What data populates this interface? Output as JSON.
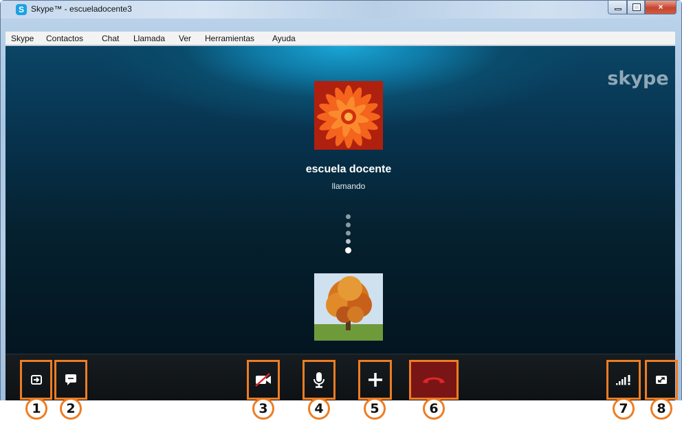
{
  "window": {
    "title": "Skype™ - escueladocente3",
    "app_icon_letter": "S",
    "controls": {
      "minimize": "minimize-icon",
      "maximize": "maximize-icon",
      "close": "×"
    }
  },
  "menu": [
    "Skype",
    "Contactos",
    "Chat",
    "Llamada",
    "Ver",
    "Herramientas",
    "Ayuda"
  ],
  "call": {
    "brand": "skype",
    "callee_name": "escuela docente",
    "status": "llamando",
    "progress_dots": 5,
    "top_avatar": "flower-photo",
    "bottom_avatar": "tree-photo"
  },
  "toolbar": {
    "buttons": [
      {
        "number": "1",
        "icon": "sidebar-toggle-icon"
      },
      {
        "number": "2",
        "icon": "chat-bubble-icon"
      },
      {
        "number": "3",
        "icon": "video-off-icon"
      },
      {
        "number": "4",
        "icon": "microphone-icon"
      },
      {
        "number": "5",
        "icon": "plus-icon"
      },
      {
        "number": "6",
        "icon": "hang-up-icon"
      },
      {
        "number": "7",
        "icon": "call-quality-icon"
      },
      {
        "number": "8",
        "icon": "fullscreen-icon"
      }
    ],
    "highlight_color": "#ee7d22",
    "hangup_color": "#e0262b"
  }
}
